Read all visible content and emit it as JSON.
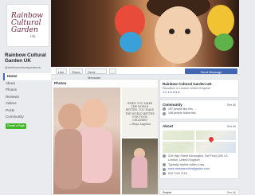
{
  "page": {
    "logo_lines": [
      "Rainbow",
      "Cultural",
      "Garden"
    ],
    "logo_suffix": "UK",
    "name": "Rainbow Cultural Garden UK",
    "handle": "@rainbowculturalgardenuk"
  },
  "nav": {
    "items": [
      "Home",
      "About",
      "Photos",
      "Reviews",
      "Videos",
      "Posts",
      "Community"
    ],
    "active": "Home",
    "create_label": "Create a Page"
  },
  "actions": {
    "like": "Like",
    "share": "Share",
    "send_message": "Send Message",
    "more": "···",
    "send_button": "Send Message"
  },
  "photos": {
    "title": "Photos",
    "quote": "WHEN YOU MAKE THE WORLD BETTER, YOU MAKE THE WORLD BETTER FOR YOUR CHILDREN",
    "quote_author": "—Maya Angelou"
  },
  "info": {
    "title": "Rainbow Cultural Garden UK",
    "category": "Education in London, United Kingdom",
    "rating": "4.5 ★★★★★"
  },
  "community": {
    "title": "Community",
    "see_all": "See All",
    "likes": "187 people like this",
    "follows": "188 people follow this"
  },
  "about": {
    "title": "About",
    "see_all": "See All",
    "address": "339 High Street Kensington, Fall Floor (200 LA",
    "city": "London, United Kingdom",
    "response": "Typically replies within a day",
    "website": "www.rainbowculturalgarden.com",
    "phone": "020 7118 3716"
  },
  "footer": {
    "left": "People",
    "right": "See All"
  },
  "colors": {
    "brand": "#4267b2",
    "create_green": "#42b72a",
    "background": "#e9ebee"
  }
}
